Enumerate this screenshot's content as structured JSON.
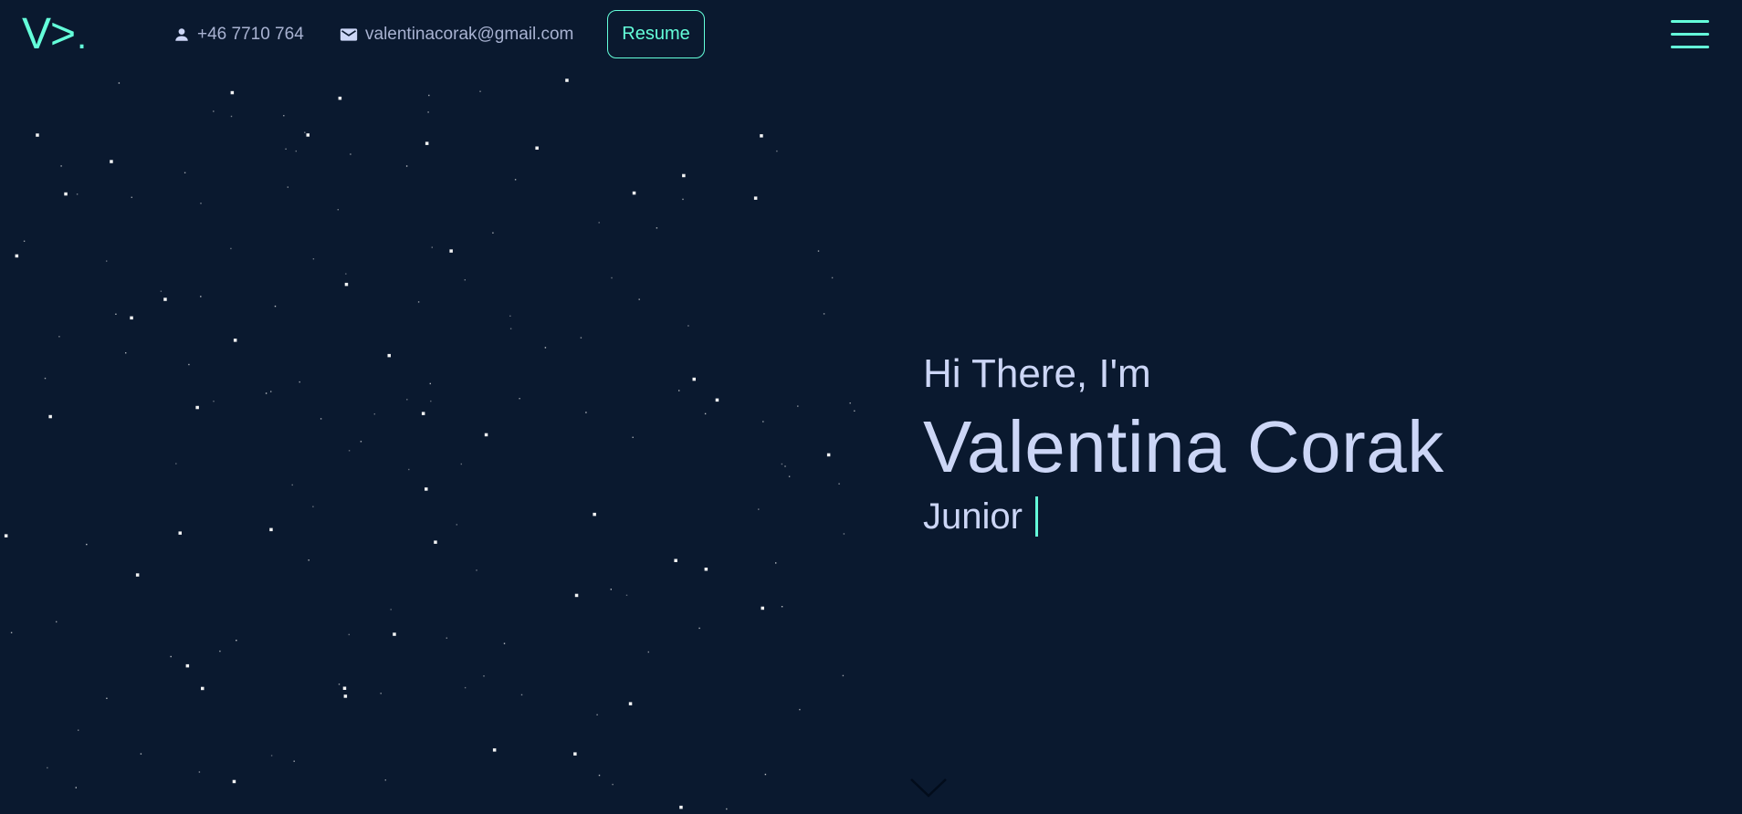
{
  "header": {
    "logo_text": "V>",
    "logo_dot": ".",
    "phone": "+46 7710 764",
    "email": "valentinacorak@gmail.com",
    "resume_label": "Resume"
  },
  "hero": {
    "greeting": "Hi There, I'm",
    "name": "Valentina Corak",
    "role": "Junior"
  },
  "colors": {
    "background": "#0a192f",
    "accent": "#64ffda",
    "text": "#ccd6f6",
    "muted_text": "#a8b2d1"
  },
  "icons": {
    "phone": "user-icon",
    "email": "mail-icon",
    "menu": "hamburger-menu-icon",
    "scroll": "chevron-down-icon"
  }
}
